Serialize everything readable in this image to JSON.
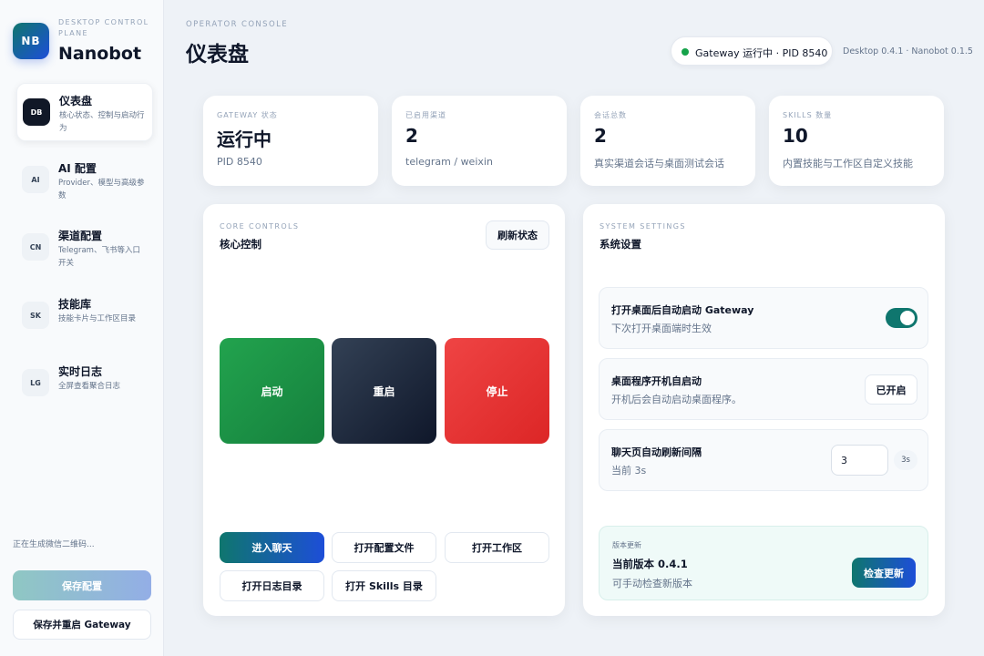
{
  "sidebar": {
    "brand": {
      "logo": "NB",
      "subtitle": "DESKTOP CONTROL PLANE",
      "name": "Nanobot"
    },
    "items": [
      {
        "badge": "DB",
        "title": "仪表盘",
        "desc": "核心状态、控制与启动行为",
        "active": true
      },
      {
        "badge": "AI",
        "title": "AI 配置",
        "desc": "Provider、模型与高级参数",
        "active": false
      },
      {
        "badge": "CN",
        "title": "渠道配置",
        "desc": "Telegram、飞书等入口开关",
        "active": false
      },
      {
        "badge": "SK",
        "title": "技能库",
        "desc": "技能卡片与工作区目录",
        "active": false
      },
      {
        "badge": "LG",
        "title": "实时日志",
        "desc": "全屏查看聚合日志",
        "active": false
      }
    ],
    "qr_status": "正在生成微信二维码...",
    "save_label": "保存配置",
    "save_restart_label": "保存并重启 Gateway"
  },
  "header": {
    "eyebrow": "OPERATOR CONSOLE",
    "title": "仪表盘",
    "gateway_status": "Gateway 运行中 · PID 8540",
    "status_color": "#16a34a",
    "version": "Desktop 0.4.1 · Nanobot 0.1.5"
  },
  "stats": [
    {
      "label": "GATEWAY 状态",
      "value": "运行中",
      "sub": "PID 8540"
    },
    {
      "label": "已启用渠道",
      "value": "2",
      "sub": "telegram / weixin"
    },
    {
      "label": "会话总数",
      "value": "2",
      "sub": "真实渠道会话与桌面测试会话"
    },
    {
      "label": "SKILLS 数量",
      "value": "10",
      "sub": "内置技能与工作区自定义技能"
    }
  ],
  "core": {
    "eyebrow": "CORE CONTROLS",
    "title": "核心控制",
    "refresh_label": "刷新状态",
    "start_label": "启动",
    "restart_label": "重启",
    "stop_label": "停止",
    "actions": {
      "chat": "进入聊天",
      "open_config": "打开配置文件",
      "open_workspace": "打开工作区",
      "open_logs": "打开日志目录",
      "open_skills": "打开 Skills 目录"
    }
  },
  "settings": {
    "eyebrow": "SYSTEM SETTINGS",
    "title": "系统设置",
    "autostart_gateway": {
      "title": "打开桌面后自动启动 Gateway",
      "desc": "下次打开桌面端时生效",
      "enabled": true
    },
    "launch_at_login": {
      "title": "桌面程序开机自启动",
      "desc": "开机后会自动启动桌面程序。",
      "button": "已开启"
    },
    "refresh_interval": {
      "title": "聊天页自动刷新间隔",
      "desc": "当前 3s",
      "value": "3",
      "unit": "3s"
    },
    "update": {
      "eyebrow": "版本更新",
      "title": "当前版本 0.4.1",
      "desc": "可手动检查新版本",
      "button": "检查更新"
    }
  },
  "colors": {
    "accent_teal": "#0f766e",
    "accent_blue": "#1d4ed8",
    "start_green": "#16a34a",
    "stop_red": "#ef4444",
    "restart_dark": "#1e293b"
  }
}
